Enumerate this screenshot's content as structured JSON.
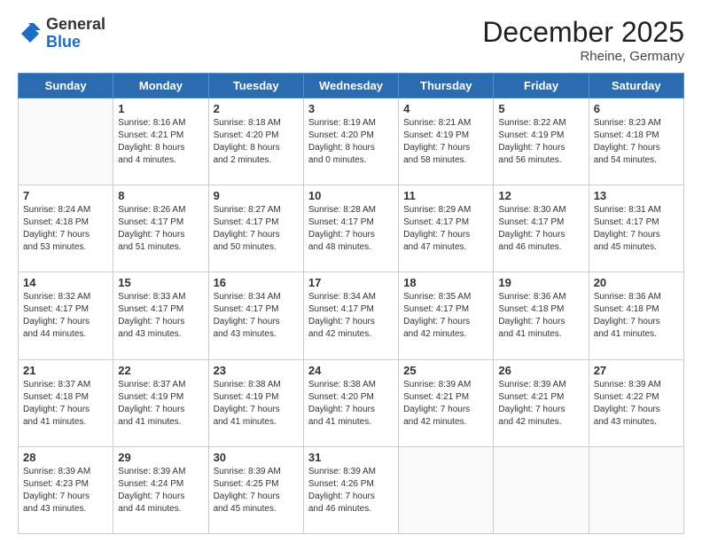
{
  "header": {
    "logo_general": "General",
    "logo_blue": "Blue",
    "month_title": "December 2025",
    "subtitle": "Rheine, Germany"
  },
  "days_of_week": [
    "Sunday",
    "Monday",
    "Tuesday",
    "Wednesday",
    "Thursday",
    "Friday",
    "Saturday"
  ],
  "weeks": [
    [
      {
        "day": "",
        "info": ""
      },
      {
        "day": "1",
        "info": "Sunrise: 8:16 AM\nSunset: 4:21 PM\nDaylight: 8 hours\nand 4 minutes."
      },
      {
        "day": "2",
        "info": "Sunrise: 8:18 AM\nSunset: 4:20 PM\nDaylight: 8 hours\nand 2 minutes."
      },
      {
        "day": "3",
        "info": "Sunrise: 8:19 AM\nSunset: 4:20 PM\nDaylight: 8 hours\nand 0 minutes."
      },
      {
        "day": "4",
        "info": "Sunrise: 8:21 AM\nSunset: 4:19 PM\nDaylight: 7 hours\nand 58 minutes."
      },
      {
        "day": "5",
        "info": "Sunrise: 8:22 AM\nSunset: 4:19 PM\nDaylight: 7 hours\nand 56 minutes."
      },
      {
        "day": "6",
        "info": "Sunrise: 8:23 AM\nSunset: 4:18 PM\nDaylight: 7 hours\nand 54 minutes."
      }
    ],
    [
      {
        "day": "7",
        "info": "Sunrise: 8:24 AM\nSunset: 4:18 PM\nDaylight: 7 hours\nand 53 minutes."
      },
      {
        "day": "8",
        "info": "Sunrise: 8:26 AM\nSunset: 4:17 PM\nDaylight: 7 hours\nand 51 minutes."
      },
      {
        "day": "9",
        "info": "Sunrise: 8:27 AM\nSunset: 4:17 PM\nDaylight: 7 hours\nand 50 minutes."
      },
      {
        "day": "10",
        "info": "Sunrise: 8:28 AM\nSunset: 4:17 PM\nDaylight: 7 hours\nand 48 minutes."
      },
      {
        "day": "11",
        "info": "Sunrise: 8:29 AM\nSunset: 4:17 PM\nDaylight: 7 hours\nand 47 minutes."
      },
      {
        "day": "12",
        "info": "Sunrise: 8:30 AM\nSunset: 4:17 PM\nDaylight: 7 hours\nand 46 minutes."
      },
      {
        "day": "13",
        "info": "Sunrise: 8:31 AM\nSunset: 4:17 PM\nDaylight: 7 hours\nand 45 minutes."
      }
    ],
    [
      {
        "day": "14",
        "info": "Sunrise: 8:32 AM\nSunset: 4:17 PM\nDaylight: 7 hours\nand 44 minutes."
      },
      {
        "day": "15",
        "info": "Sunrise: 8:33 AM\nSunset: 4:17 PM\nDaylight: 7 hours\nand 43 minutes."
      },
      {
        "day": "16",
        "info": "Sunrise: 8:34 AM\nSunset: 4:17 PM\nDaylight: 7 hours\nand 43 minutes."
      },
      {
        "day": "17",
        "info": "Sunrise: 8:34 AM\nSunset: 4:17 PM\nDaylight: 7 hours\nand 42 minutes."
      },
      {
        "day": "18",
        "info": "Sunrise: 8:35 AM\nSunset: 4:17 PM\nDaylight: 7 hours\nand 42 minutes."
      },
      {
        "day": "19",
        "info": "Sunrise: 8:36 AM\nSunset: 4:18 PM\nDaylight: 7 hours\nand 41 minutes."
      },
      {
        "day": "20",
        "info": "Sunrise: 8:36 AM\nSunset: 4:18 PM\nDaylight: 7 hours\nand 41 minutes."
      }
    ],
    [
      {
        "day": "21",
        "info": "Sunrise: 8:37 AM\nSunset: 4:18 PM\nDaylight: 7 hours\nand 41 minutes."
      },
      {
        "day": "22",
        "info": "Sunrise: 8:37 AM\nSunset: 4:19 PM\nDaylight: 7 hours\nand 41 minutes."
      },
      {
        "day": "23",
        "info": "Sunrise: 8:38 AM\nSunset: 4:19 PM\nDaylight: 7 hours\nand 41 minutes."
      },
      {
        "day": "24",
        "info": "Sunrise: 8:38 AM\nSunset: 4:20 PM\nDaylight: 7 hours\nand 41 minutes."
      },
      {
        "day": "25",
        "info": "Sunrise: 8:39 AM\nSunset: 4:21 PM\nDaylight: 7 hours\nand 42 minutes."
      },
      {
        "day": "26",
        "info": "Sunrise: 8:39 AM\nSunset: 4:21 PM\nDaylight: 7 hours\nand 42 minutes."
      },
      {
        "day": "27",
        "info": "Sunrise: 8:39 AM\nSunset: 4:22 PM\nDaylight: 7 hours\nand 43 minutes."
      }
    ],
    [
      {
        "day": "28",
        "info": "Sunrise: 8:39 AM\nSunset: 4:23 PM\nDaylight: 7 hours\nand 43 minutes."
      },
      {
        "day": "29",
        "info": "Sunrise: 8:39 AM\nSunset: 4:24 PM\nDaylight: 7 hours\nand 44 minutes."
      },
      {
        "day": "30",
        "info": "Sunrise: 8:39 AM\nSunset: 4:25 PM\nDaylight: 7 hours\nand 45 minutes."
      },
      {
        "day": "31",
        "info": "Sunrise: 8:39 AM\nSunset: 4:26 PM\nDaylight: 7 hours\nand 46 minutes."
      },
      {
        "day": "",
        "info": ""
      },
      {
        "day": "",
        "info": ""
      },
      {
        "day": "",
        "info": ""
      }
    ]
  ]
}
